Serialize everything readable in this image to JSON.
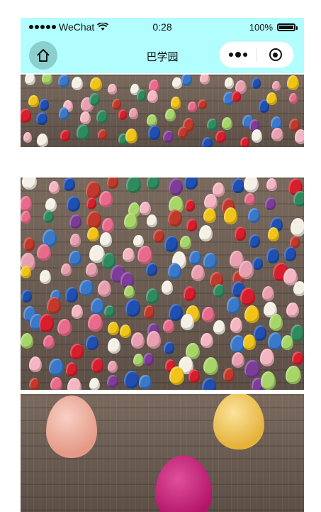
{
  "status_bar": {
    "carrier": "WeChat",
    "time": "0:28",
    "battery_text": "100%",
    "battery_level": 1.0,
    "signal_dots": 5,
    "wifi_icon": "wifi-icon"
  },
  "nav_bar": {
    "title": "巴学园",
    "home_icon": "home-icon",
    "more_icon": "more-dots-icon",
    "close_icon": "close-target-icon",
    "background_color": "#b2fdfd"
  },
  "feed": {
    "images": [
      {
        "subject": "knitted-eggs-on-wood"
      },
      {
        "subject": "knitted-eggs-on-wood"
      },
      {
        "subject": "knitted-eggs-closeup"
      }
    ]
  }
}
